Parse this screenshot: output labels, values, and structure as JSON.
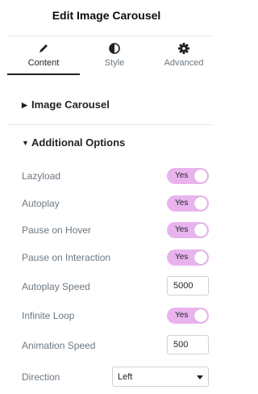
{
  "panel": {
    "title": "Edit Image Carousel"
  },
  "tabs": [
    {
      "label": "Content",
      "icon": "pencil-icon",
      "active": true
    },
    {
      "label": "Style",
      "icon": "contrast-icon",
      "active": false
    },
    {
      "label": "Advanced",
      "icon": "gear-icon",
      "active": false
    }
  ],
  "sections": {
    "image_carousel": {
      "label": "Image Carousel",
      "expanded": false
    },
    "additional_options": {
      "label": "Additional Options",
      "expanded": true
    }
  },
  "options": {
    "lazyload": {
      "label": "Lazyload",
      "value": "Yes"
    },
    "autoplay": {
      "label": "Autoplay",
      "value": "Yes"
    },
    "pause_on_hover": {
      "label": "Pause on Hover",
      "value": "Yes"
    },
    "pause_on_interaction": {
      "label": "Pause on Interaction",
      "value": "Yes"
    },
    "autoplay_speed": {
      "label": "Autoplay Speed",
      "value": "5000"
    },
    "infinite_loop": {
      "label": "Infinite Loop",
      "value": "Yes"
    },
    "animation_speed": {
      "label": "Animation Speed",
      "value": "500"
    },
    "direction": {
      "label": "Direction",
      "value": "Left"
    }
  },
  "colors": {
    "toggle_on": "#e9b4ee",
    "text": "#6d7882",
    "heading": "#1f2124"
  }
}
